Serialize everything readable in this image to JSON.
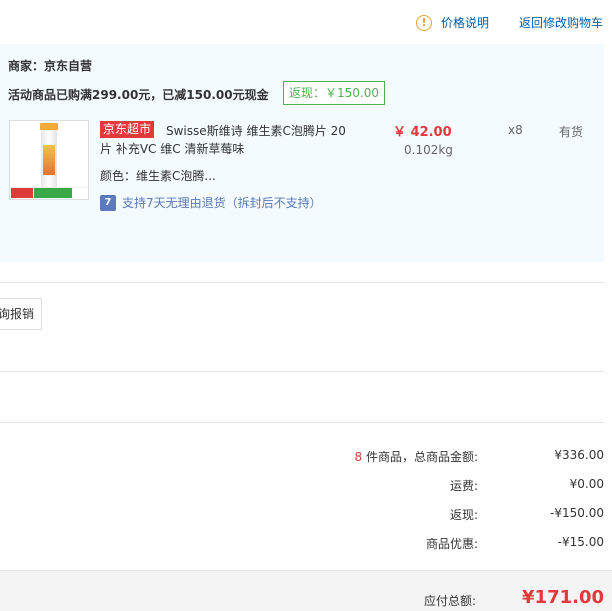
{
  "header": {
    "price_info_icon": "info-circle-icon",
    "price_info_label": "价格说明",
    "back_link": "返回修改购物车"
  },
  "shop": {
    "merchant": "商家：京东自营",
    "promo": "活动商品已购满299.00元，已减150.00元现金",
    "rebate_badge": "返现：￥150.00",
    "colors": {
      "panel_bg": "#f3fbfe",
      "rebate_green": "#4fb24f",
      "price_red": "#e4393c"
    }
  },
  "item": {
    "tag": "京东超市",
    "name": "Swisse斯维诗 维生素C泡腾片 20片 补充VC 维C 清新草莓味",
    "color": "颜色：维生素C泡腾...",
    "return_icon": "7",
    "return_text": "支持7天无理由退货（拆封后不支持）",
    "price": "￥ 42.00",
    "weight": "0.102kg",
    "quantity": "x8",
    "stock": "有货"
  },
  "invoice": {
    "button_label": "询报销"
  },
  "summary": {
    "count": "8",
    "count_label": " 件商品，总商品金额:",
    "goods_total": "¥336.00",
    "shipping_label": "运费:",
    "shipping_value": "¥0.00",
    "rebate_label": "返现:",
    "rebate_value": "-¥150.00",
    "discount_label": "商品优惠:",
    "discount_value": "-¥15.00"
  },
  "total": {
    "label": "应付总额:",
    "value": "¥171.00"
  }
}
